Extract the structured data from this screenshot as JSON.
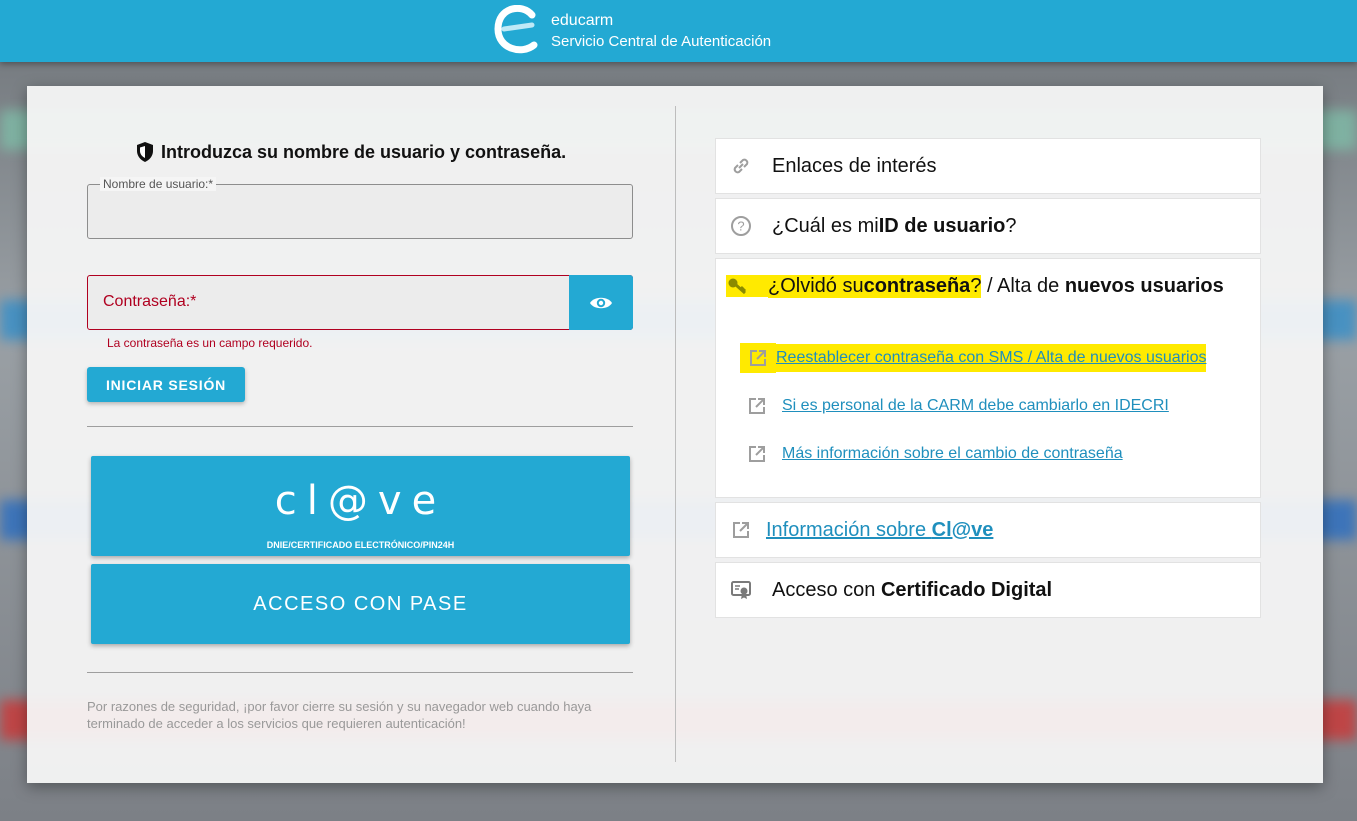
{
  "header": {
    "brand": "educarm",
    "subtitle": "Servicio Central de Autenticación"
  },
  "login": {
    "title": "Introduzca su nombre de usuario y contraseña.",
    "username_label": "Nombre de usuario:*",
    "username_value": "",
    "password_label": "Contraseña:*",
    "password_error": "La contraseña es un campo requerido.",
    "submit_label": "INICIAR SESIÓN",
    "clave_logo": "cl@ve",
    "clave_subtitle": "DNIE/CERTIFICADO ELECTRÓNICO/PIN24H",
    "pase_label": "ACCESO CON PASE",
    "security_note": "Por razones de seguridad, ¡por favor cierre su sesión y su navegador web cuando haya terminado de acceder a los servicios que requieren autenticación!"
  },
  "panels": {
    "links_title": "Enlaces de interés",
    "userid_prefix": "¿Cuál es mi ",
    "userid_bold": "ID de usuario",
    "userid_suffix": "?",
    "forgot_prefix": "¿Olvidó su ",
    "forgot_bold": "contraseña",
    "forgot_mid": "? / Alta de ",
    "forgot_bold2": "nuevos usuarios",
    "forgot_links": [
      "Reestablecer contraseña con SMS / Alta de nuevos usuarios",
      "Si es personal de la CARM debe cambiarlo en IDECRI",
      "Más información sobre el cambio de contraseña"
    ],
    "clave_info_prefix": "Información sobre ",
    "clave_info_bold": "Cl@ve",
    "cert_prefix": "Acceso con ",
    "cert_bold": "Certificado Digital"
  },
  "colors": {
    "brand": "#23a9d3",
    "error": "#b00020",
    "highlight": "#ffea00",
    "link": "#1f8fbd"
  }
}
